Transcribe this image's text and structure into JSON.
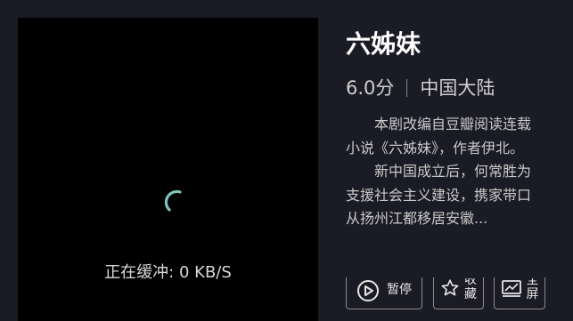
{
  "player": {
    "buffering_text": "正在缓冲: 0 KB/S"
  },
  "info": {
    "title": "六姊妹",
    "rating": "6.0分",
    "region": "中国大陆",
    "description_p1": "本剧改编自豆瓣阅读连载小说《六姊妹》，作者伊北。",
    "description_p2": "新中国成立后，何常胜为支援社会主义建设，携家带口从扬州江都移居安徽..."
  },
  "controls": {
    "pause_label": "暂停",
    "fav_label_top": "收",
    "fav_label_bottom": "藏",
    "full_label_top": "全",
    "full_label_bottom": "屏",
    "pause_icon": "pause-circle-icon",
    "fav_icon": "star-icon",
    "full_icon": "fullscreen-icon"
  },
  "colors": {
    "background": "#1a1b24",
    "spinner": "#7fc4bd"
  }
}
